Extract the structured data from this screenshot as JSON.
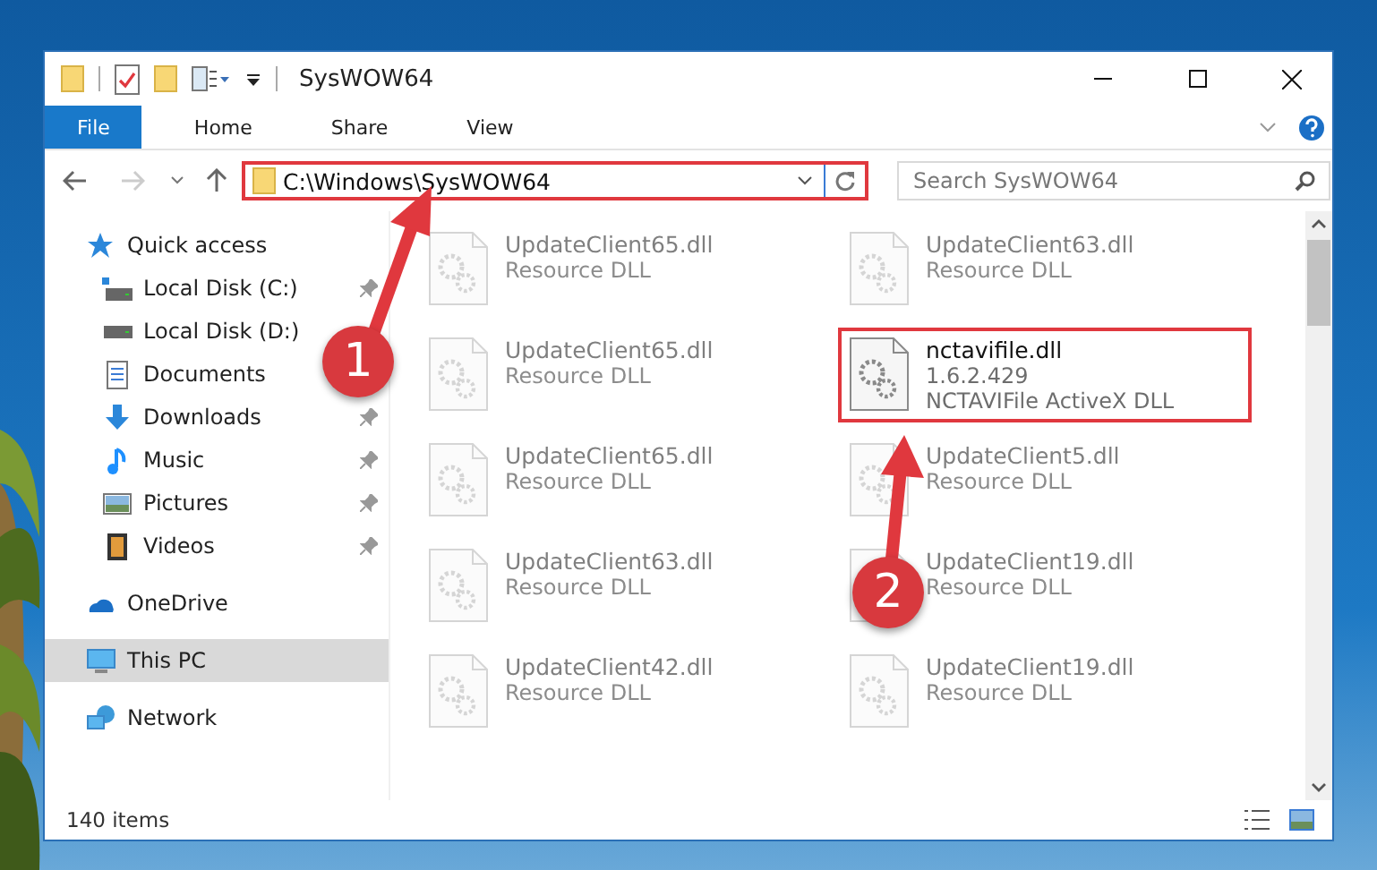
{
  "window": {
    "title": "SysWOW64"
  },
  "ribbon_tabs": [
    {
      "label": "File",
      "kind": "file-menu"
    },
    {
      "label": "Home",
      "kind": "tab"
    },
    {
      "label": "Share",
      "kind": "tab"
    },
    {
      "label": "View",
      "kind": "tab"
    }
  ],
  "address": {
    "path": "C:\\Windows\\SysWOW64",
    "highlighted": true
  },
  "search": {
    "placeholder": "Search SysWOW64"
  },
  "sidebar": {
    "items": [
      {
        "label": "Quick access",
        "kind": "star",
        "selected": false,
        "children": [
          {
            "label": "Local Disk (C:)",
            "kind": "system-drive",
            "pinned": true,
            "selected": false
          },
          {
            "label": "Local Disk (D:)",
            "kind": "drive",
            "pinned": false,
            "selected": false
          },
          {
            "label": "Documents",
            "kind": "document",
            "pinned": false,
            "selected": false
          },
          {
            "label": "Downloads",
            "kind": "download",
            "pinned": true,
            "selected": false
          },
          {
            "label": "Music",
            "kind": "music",
            "pinned": true,
            "selected": false
          },
          {
            "label": "Pictures",
            "kind": "pictures",
            "pinned": true,
            "selected": false
          },
          {
            "label": "Videos",
            "kind": "videos",
            "pinned": true,
            "selected": false
          }
        ]
      },
      {
        "label": "OneDrive",
        "kind": "cloud",
        "selected": false
      },
      {
        "label": "This PC",
        "kind": "computer",
        "selected": true
      },
      {
        "label": "Network",
        "kind": "network",
        "selected": false
      }
    ]
  },
  "files": [
    {
      "name": "UpdateClient65.dll",
      "details": [
        "Resource DLL"
      ],
      "blurred": true,
      "highlighted": false
    },
    {
      "name": "UpdateClient63.dll",
      "details": [
        "Resource DLL"
      ],
      "blurred": true,
      "highlighted": false
    },
    {
      "name": "UpdateClient65.dll",
      "details": [
        "Resource DLL"
      ],
      "blurred": true,
      "highlighted": false
    },
    {
      "name": "nctavifile.dll",
      "details": [
        "1.6.2.429",
        "NCTAVIFile ActiveX DLL"
      ],
      "blurred": false,
      "highlighted": true
    },
    {
      "name": "UpdateClient65.dll",
      "details": [
        "Resource DLL"
      ],
      "blurred": true,
      "highlighted": false
    },
    {
      "name": "UpdateClient5.dll",
      "details": [
        "Resource DLL"
      ],
      "blurred": true,
      "highlighted": false
    },
    {
      "name": "UpdateClient63.dll",
      "details": [
        "Resource DLL"
      ],
      "blurred": true,
      "highlighted": false
    },
    {
      "name": "UpdateClient19.dll",
      "details": [
        "Resource DLL"
      ],
      "blurred": true,
      "highlighted": false
    },
    {
      "name": "UpdateClient42.dll",
      "details": [
        "Resource DLL"
      ],
      "blurred": true,
      "highlighted": false
    },
    {
      "name": "UpdateClient19.dll",
      "details": [
        "Resource DLL"
      ],
      "blurred": true,
      "highlighted": false
    }
  ],
  "status_bar": {
    "item_count": "140 items"
  },
  "annotations": [
    {
      "label": "1"
    },
    {
      "label": "2"
    }
  ]
}
